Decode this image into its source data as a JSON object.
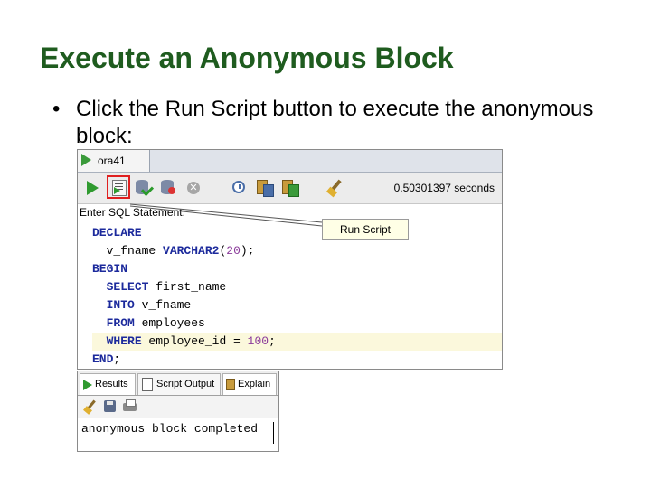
{
  "slide": {
    "title": "Execute an Anonymous Block",
    "bullet_symbol": "•",
    "bullet_text": "Click the Run Script button to execute the anonymous block:"
  },
  "worksheet": {
    "tab_label": "ora41",
    "toolbar": {
      "icons": [
        "run-statement-icon",
        "run-script-icon",
        "commit-icon",
        "rollback-icon",
        "cancel-icon",
        "sql-history-icon",
        "explain-plan-icon",
        "autotrace-icon",
        "clear-icon"
      ],
      "highlighted_button": "run-script-button"
    },
    "execution_time": "0.50301397 seconds",
    "sql_label": "Enter SQL Statement:",
    "tooltip": "Run Script",
    "code": {
      "line1_kw": "DECLARE",
      "line2_ident": "v_fname ",
      "line2_type": "VARCHAR2",
      "line2_open": "(",
      "line2_num": "20",
      "line2_close": ");",
      "line3_kw": "BEGIN",
      "line4_kw": "SELECT",
      "line4_rest": " first_name",
      "line5_kw": "INTO",
      "line5_rest": " v_fname",
      "line6_kw": "FROM",
      "line6_rest": " employees",
      "line7_kw": "WHERE",
      "line7_rest": " employee_id = ",
      "line7_num": "100",
      "line7_end": ";",
      "line8_kw": "END",
      "line8_end": ";"
    },
    "colors": {
      "keyword": "#1c2a9c",
      "number": "#8a3a9a",
      "highlight_line": "#fbf8dc",
      "run_script_border": "#e02020"
    }
  },
  "output": {
    "tabs": [
      "Results",
      "Script Output",
      "Explain"
    ],
    "active_tab": "Script Output",
    "toolbar_icons": [
      "clear-icon",
      "save-icon",
      "print-icon"
    ],
    "text": "anonymous block completed"
  },
  "colors": {
    "title": "#1f5c1f"
  }
}
